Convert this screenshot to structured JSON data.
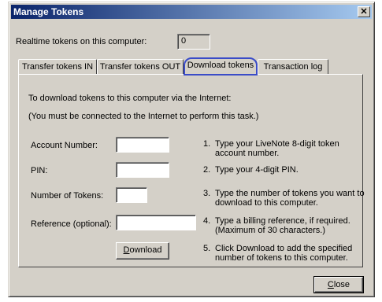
{
  "window": {
    "title": "Manage Tokens",
    "close_glyph": "✕"
  },
  "realtime": {
    "label": "Realtime tokens on this computer:",
    "value": "0"
  },
  "tabs": [
    {
      "label": "Transfer tokens IN"
    },
    {
      "label": "Transfer tokens OUT"
    },
    {
      "label": "Download tokens",
      "active": true
    },
    {
      "label": "Transaction log"
    }
  ],
  "panel": {
    "intro_line1": "To download tokens to this computer via the Internet:",
    "intro_line2": "(You must be connected to the Internet to perform this task.)",
    "fields": {
      "account": {
        "label": "Account Number:",
        "value": ""
      },
      "pin": {
        "label": "PIN:",
        "value": ""
      },
      "tokens": {
        "label": "Number of Tokens:",
        "value": ""
      },
      "reference": {
        "label": "Reference (optional):",
        "value": ""
      }
    },
    "steps": [
      {
        "num": "1.",
        "line1": "Type your LiveNote 8-digit token",
        "line2": "account number."
      },
      {
        "num": "2.",
        "line1": "Type your 4-digit PIN.",
        "line2": ""
      },
      {
        "num": "3.",
        "line1": "Type the number of tokens you want to",
        "line2": "download to this computer."
      },
      {
        "num": "4.",
        "line1": "Type a billing reference, if required.",
        "line2": "(Maximum of 30 characters.)"
      },
      {
        "num": "5.",
        "line1": "Click Download to add the specified",
        "line2": "number of tokens to this computer."
      }
    ],
    "download_mnemonic": "D",
    "download_rest": "ownload"
  },
  "close_button": {
    "mnemonic": "C",
    "rest": "lose"
  },
  "icons": {
    "close": "close-icon"
  }
}
